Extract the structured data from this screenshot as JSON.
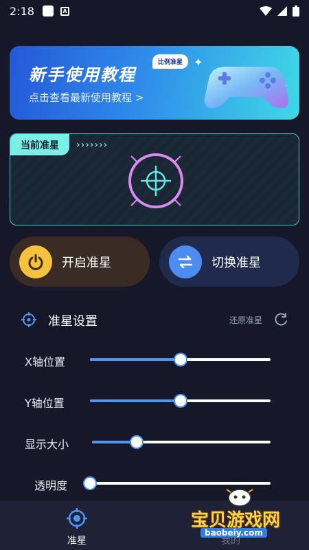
{
  "status_bar": {
    "time": "2:18",
    "a_badge": "A"
  },
  "banner": {
    "title": "新手使用教程",
    "subtitle": "点击查看最新使用教程 >",
    "badge": "比例准星"
  },
  "crosshair_card": {
    "tag": "当前准星",
    "chevrons": "›››››››"
  },
  "buttons": {
    "start_label": "开启准星",
    "switch_label": "切换准星"
  },
  "settings": {
    "title": "准星设置",
    "restore_label": "还原准星",
    "sliders": [
      {
        "label": "X轴位置",
        "percent": 50
      },
      {
        "label": "Y轴位置",
        "percent": 50
      },
      {
        "label": "显示大小",
        "percent": 25
      },
      {
        "label": "透明度",
        "percent": 0
      }
    ]
  },
  "bottom_nav": {
    "items": [
      {
        "label": "准星"
      },
      {
        "label": "我的"
      }
    ]
  },
  "watermark": {
    "text": "宝贝游戏网",
    "url": "baobeiy.com"
  },
  "colors": {
    "background": "#16182a",
    "accent_blue": "#4f95f2",
    "accent_teal": "#7deee6",
    "start_yellow": "#f6c23c",
    "crosshair_pink": "#d98cf0"
  }
}
